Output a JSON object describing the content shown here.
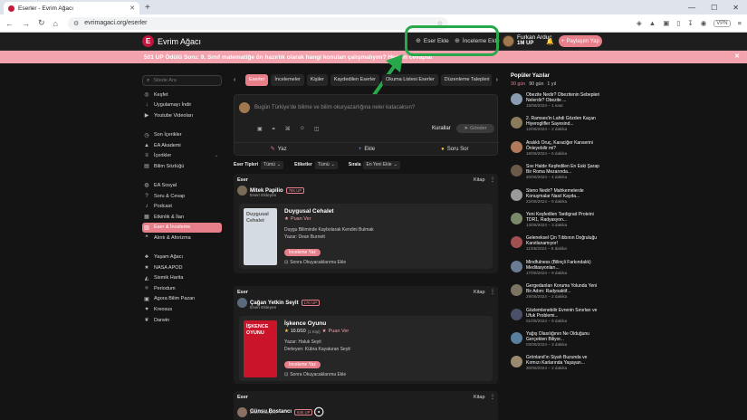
{
  "browser": {
    "tab_title": "Eserler - Evrim Ağacı",
    "url": "evrimagaci.org/eserler",
    "vpn_label": "VPN"
  },
  "header": {
    "brand": "Evrim Ağacı",
    "add_work": "Eser Ekle",
    "add_review": "İnceleme Ekle",
    "user_name": "Furkan Arduç",
    "user_points": "1M UP",
    "share_button": "Paylaşım Yap"
  },
  "banner": {
    "text": "501 UP Ödülü Soru: 9. Sınıf matematiğe ön hazırlık olarak hangi konuları çalışmalıyım? Hemen cevapla!"
  },
  "sidebar": {
    "search_placeholder": "Sitede Ara",
    "groups": [
      [
        {
          "label": "Keşfet",
          "icon": "compass-icon"
        },
        {
          "label": "Uygulamayı İndir",
          "icon": "download-icon"
        },
        {
          "label": "Youtube Videoları",
          "icon": "play-icon"
        }
      ],
      [
        {
          "label": "Son İçerikler",
          "icon": "clock-icon"
        },
        {
          "label": "EA Akademi",
          "icon": "graduation-icon"
        },
        {
          "label": "İçerikler",
          "icon": "list-icon",
          "has_chevron": true
        },
        {
          "label": "Bilim Sözlüğü",
          "icon": "book-icon"
        }
      ],
      [
        {
          "label": "EA Sosyal",
          "icon": "globe-icon"
        },
        {
          "label": "Soru & Cevap",
          "icon": "question-icon"
        },
        {
          "label": "Podcast",
          "icon": "microphone-icon"
        },
        {
          "label": "Etkinlik & İlan",
          "icon": "calendar-icon"
        },
        {
          "label": "Eser & İnceleme",
          "icon": "book-open-icon",
          "active": true
        },
        {
          "label": "Alıntı & Aforizma",
          "icon": "quote-icon"
        }
      ],
      [
        {
          "label": "Yaşam Ağacı",
          "icon": "tree-icon"
        },
        {
          "label": "NASA APOD",
          "icon": "star-icon"
        },
        {
          "label": "Sismik Harita",
          "icon": "map-icon"
        },
        {
          "label": "Periodum",
          "icon": "atom-icon"
        },
        {
          "label": "Agora Bilim Pazarı",
          "icon": "shop-icon"
        },
        {
          "label": "Kreosus",
          "icon": "heart-icon"
        },
        {
          "label": "Darwin",
          "icon": "leaf-icon"
        }
      ]
    ]
  },
  "content_tabs": [
    "Eserler",
    "İncelemeler",
    "Kişiler",
    "Kaydedilen Eserler",
    "Okuma Listesi Eserler",
    "Düzenleme Talepleri"
  ],
  "composer": {
    "placeholder": "Bugün Türkiye'de bilime ve bilim okuryazarlığına neler katacaksın?",
    "rules": "Kurallar",
    "send": "Gönder",
    "write": "Yaz",
    "add": "Ekle",
    "ask": "Soru Sor"
  },
  "filters": [
    {
      "label": "Eser Tipleri",
      "value": "Tümü"
    },
    {
      "label": "Etiketler",
      "value": "Tümü"
    },
    {
      "label": "Sırala",
      "value": "En Yeni Ekle"
    }
  ],
  "feed": [
    {
      "type": "Eser",
      "kind": "Kitap",
      "user": "Mitek Papilio",
      "badge": "76K UP",
      "role": "Eseri Ekleyen",
      "title": "Duygusal Cehalet",
      "rate_label": "Puan Ver",
      "lines": [
        "Duygu Biliminde Kaybolarak Kendini Bulmak",
        "Yazar: Dean Burnett"
      ],
      "review_btn": "İnceleme Yaz",
      "later": "Sonra Okuyacaklarıma Ekle",
      "cover_color": "#d5dbe2",
      "cover_text": "Duygusal Cehalet"
    },
    {
      "type": "Eser",
      "kind": "Kitap",
      "user": "Çağan Yetkin Seyit",
      "badge": "17K UP",
      "role": "Eseri Ekleyen",
      "title": "İşkence Oyunu",
      "rating": "10.0",
      "rating_scale": "/10",
      "rating_count": "(1 Kişi)",
      "rate_label": "Puan Ver",
      "lines": [
        "Yazar: Haluk Seyit",
        "Derleyen: Kübra Kayaturan Seyit"
      ],
      "review_btn": "İnceleme Yaz",
      "later": "Sonra Okuyacaklarıma Ekle",
      "cover_color": "#c9142a",
      "cover_text": "İŞKENCE OYUNU"
    },
    {
      "type": "Eser",
      "kind": "Kitap",
      "user": "Günsu Bostancı",
      "badge": "63K UP",
      "role": "Eseri Ekleyen"
    }
  ],
  "popular": {
    "title": "Popüler Yazılar",
    "periods": [
      "30 gün",
      "90 gün",
      "1 yıl"
    ],
    "items": [
      {
        "title": "Obezite Nedir? Obezitenin Sebepleri Nelerdir? Obezite ...",
        "meta": "15/06/2024 – 1 saat",
        "color": "#8a9cb0"
      },
      {
        "title": "2. Ramses'in Lahdi Gözden Kaçan Hiyeroglifler Sayesind...",
        "meta": "12/06/2024 – 2 dakika",
        "color": "#8b7a5c"
      },
      {
        "title": "Aralıklı Oruç, Karaciğer Kanserini Önleyebilir mi?",
        "meta": "18/06/2024 – 6 dakika",
        "color": "#b07a5a"
      },
      {
        "title": "Sıvı Halde Keşfedilen En Eski Şarap Bir Roma Mezarında...",
        "meta": "20/06/2024 – 4 dakika",
        "color": "#6c5a48"
      },
      {
        "title": "Steno Nedir? Mahkemelerde Konuşmalar Nasıl Kayda...",
        "meta": "22/06/2024 – 9 dakika",
        "color": "#9a9a9a"
      },
      {
        "title": "Yeni Keşfedilen Tardigrad Proteini TDR1, Radyasyon...",
        "meta": "13/06/2024 – 3 dakika",
        "color": "#7a8a6a"
      },
      {
        "title": "Geleneksel Çin Tıbbının Doğruluğu Kanıtlanamıyor!",
        "meta": "11/06/2024 – 9 dakika",
        "color": "#a05050"
      },
      {
        "title": "Mindfulness (Bilinçli Farkındalık) Meditasyonları...",
        "meta": "17/06/2024 – 9 dakika",
        "color": "#6a7c94"
      },
      {
        "title": "Gergedanları Koruma Yolunda Yeni Bir Adım: Radyoaktif...",
        "meta": "29/06/2024 – 2 dakika",
        "color": "#7c7460"
      },
      {
        "title": "Gözlemlenebilir Evrenin Sınırları ve Ufuk Problemi...",
        "meta": "01/06/2024 – 9 dakika",
        "color": "#4a5068"
      },
      {
        "title": "Yağış Olasılığının Ne Olduğunu Gerçekten Biliyor...",
        "meta": "03/06/2024 – 3 dakika",
        "color": "#5a80a0"
      },
      {
        "title": "Grönland'ın Siyah Buzunda ve Kırmızı Karlarında Yaşayan...",
        "meta": "30/06/2024 – 2 dakika",
        "color": "#9c8a70"
      }
    ]
  },
  "colors": {
    "accent": "#e77f8b",
    "brand": "#c2153c",
    "annotation": "#27a84a"
  }
}
